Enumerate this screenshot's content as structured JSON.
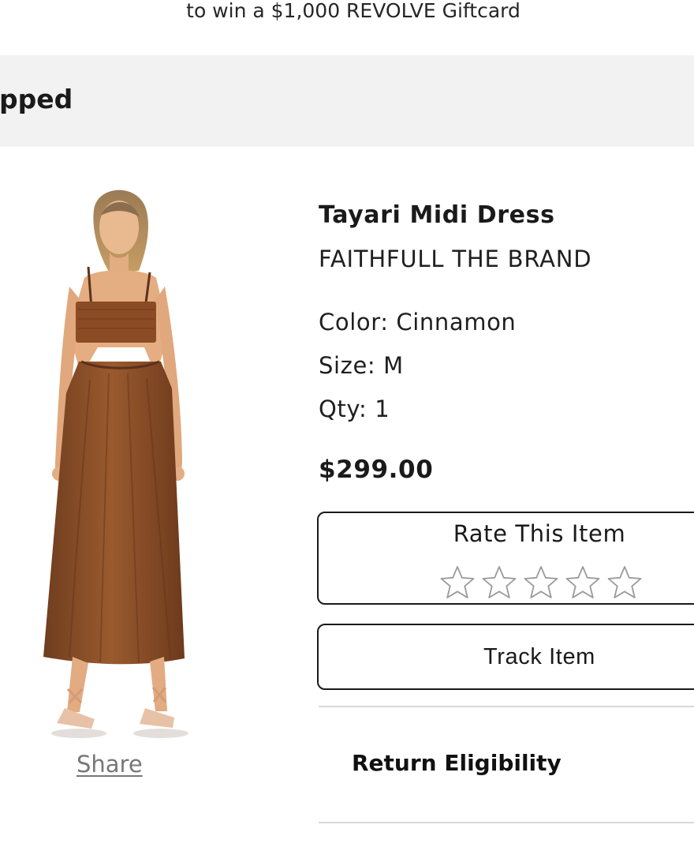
{
  "promo": {
    "text": "to win a $1,000 REVOLVE Giftcard"
  },
  "order_status": {
    "text": "pped"
  },
  "product": {
    "name": "Tayari Midi Dress",
    "brand": "FAITHFULL THE BRAND",
    "color_line": "Color: Cinnamon",
    "size_line": "Size: M",
    "qty_line": "Qty: 1",
    "price": "$299.00",
    "image_icon": "product-photo-dress",
    "dress_color": "#8b4f27"
  },
  "share": {
    "label": "Share"
  },
  "rating": {
    "label": "Rate This Item",
    "stars": [
      {
        "icon": "star-outline-icon"
      },
      {
        "icon": "star-outline-icon"
      },
      {
        "icon": "star-outline-icon"
      },
      {
        "icon": "star-outline-icon"
      },
      {
        "icon": "star-outline-icon"
      }
    ],
    "current_rating": 0,
    "max_rating": 5
  },
  "actions": {
    "track_label": "Track Item"
  },
  "returns": {
    "label": "Return Eligibility"
  },
  "colors": {
    "background": "#ffffff",
    "status_bar": "#f2f2f2",
    "text": "#1a1a1a",
    "muted_link": "#777777",
    "border": "#1a1a1a",
    "divider": "#d8d8d8",
    "star_outline": "#9a9a9a"
  }
}
